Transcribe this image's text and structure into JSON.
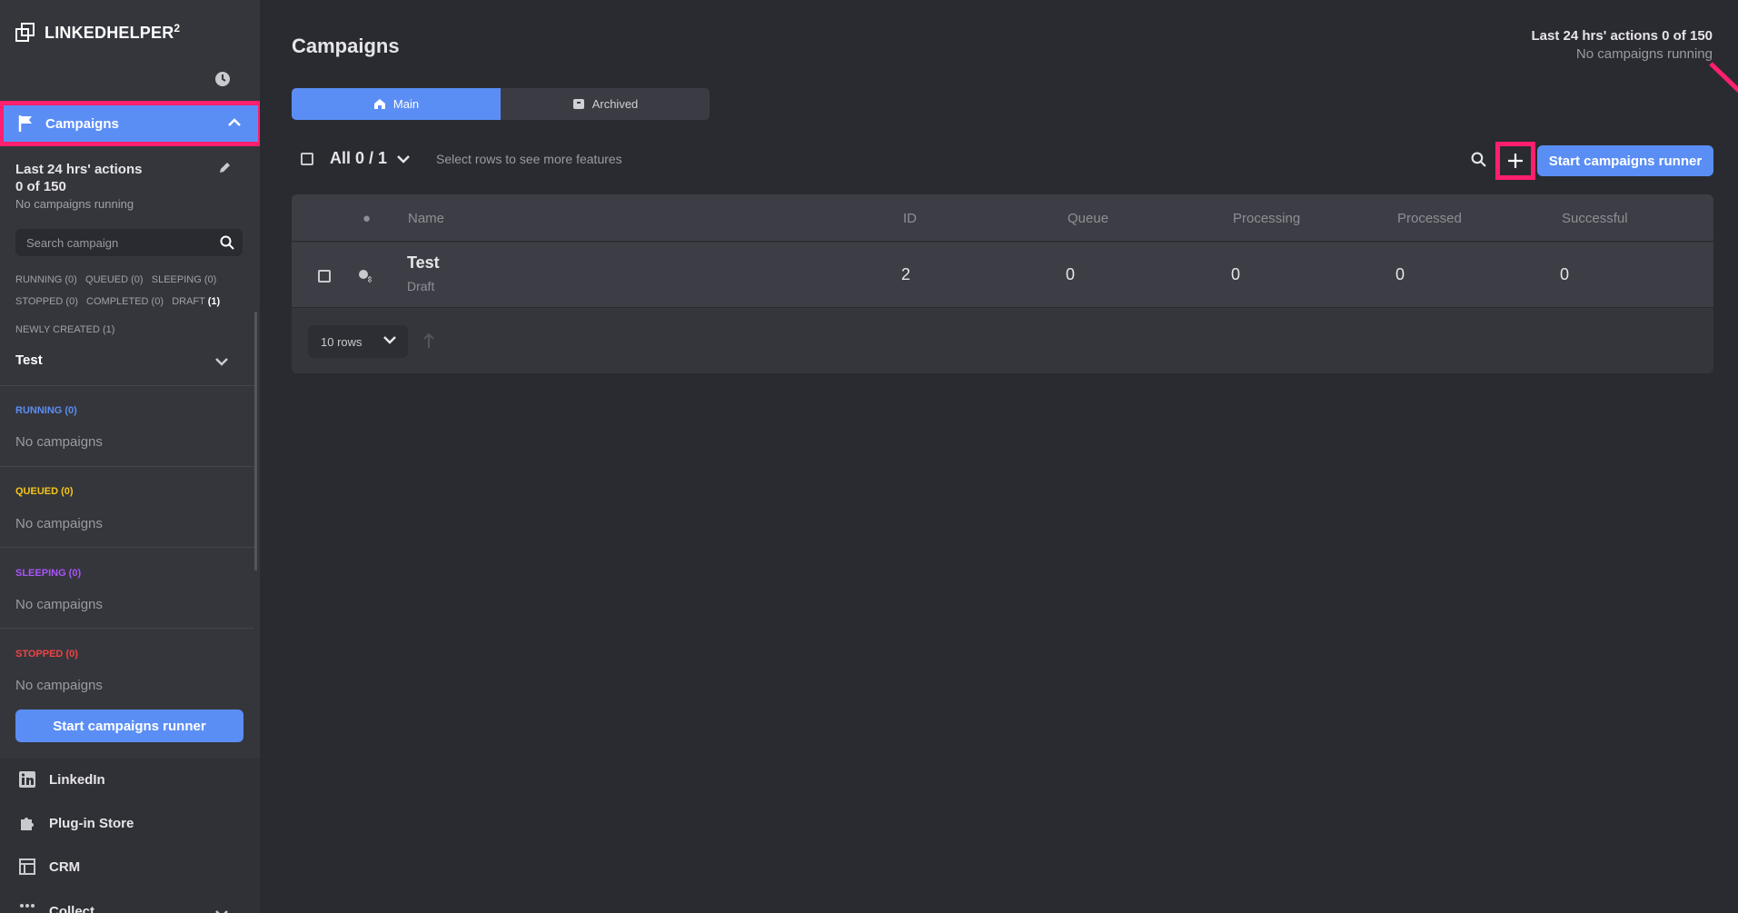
{
  "app": {
    "name": "LINKEDHELPER",
    "version_sup": "2"
  },
  "sidebar": {
    "campaigns_label": "Campaigns",
    "stats_line1": "Last 24 hrs' actions",
    "stats_line2": "0 of 150",
    "stats_sub": "No campaigns running",
    "search_placeholder": "Search campaign",
    "filters": {
      "running": "RUNNING (0)",
      "queued": "QUEUED (0)",
      "sleeping": "SLEEPING (0)",
      "stopped": "STOPPED (0)",
      "completed": "COMPLETED (0)",
      "draft": "DRAFT",
      "draft_count": "(1)",
      "newly_created": "NEWLY CREATED (1)"
    },
    "campaign_item": "Test",
    "sections": [
      {
        "title": "RUNNING (0)",
        "empty": "No campaigns",
        "color": "#5b8ef5"
      },
      {
        "title": "QUEUED (0)",
        "empty": "No campaigns",
        "color": "#f5c518"
      },
      {
        "title": "SLEEPING (0)",
        "empty": "No campaigns",
        "color": "#a855f7"
      },
      {
        "title": "STOPPED (0)",
        "empty": "No campaigns",
        "color": "#ef4444"
      }
    ],
    "runner_button": "Start campaigns runner",
    "nav": [
      "LinkedIn",
      "Plug-in Store",
      "CRM",
      "Collect"
    ]
  },
  "main": {
    "title": "Campaigns",
    "top_stats_line1": "Last 24 hrs' actions 0 of 150",
    "top_stats_line2": "No campaigns running",
    "tabs": [
      "Main",
      "Archived"
    ],
    "select_label": "All 0 / 1",
    "select_hint": "Select rows to see more features",
    "runner_button": "Start campaigns runner",
    "table": {
      "headers": [
        "Name",
        "ID",
        "Queue",
        "Processing",
        "Processed",
        "Successful"
      ],
      "dot": "●",
      "rows": [
        {
          "name": "Test",
          "status": "Draft",
          "id": "2",
          "queue": "0",
          "processing": "0",
          "processed": "0",
          "successful": "0"
        }
      ]
    },
    "pager_label": "10 rows"
  },
  "colors": {
    "accent": "#5b8ef5",
    "highlight": "#ff1f6e"
  }
}
